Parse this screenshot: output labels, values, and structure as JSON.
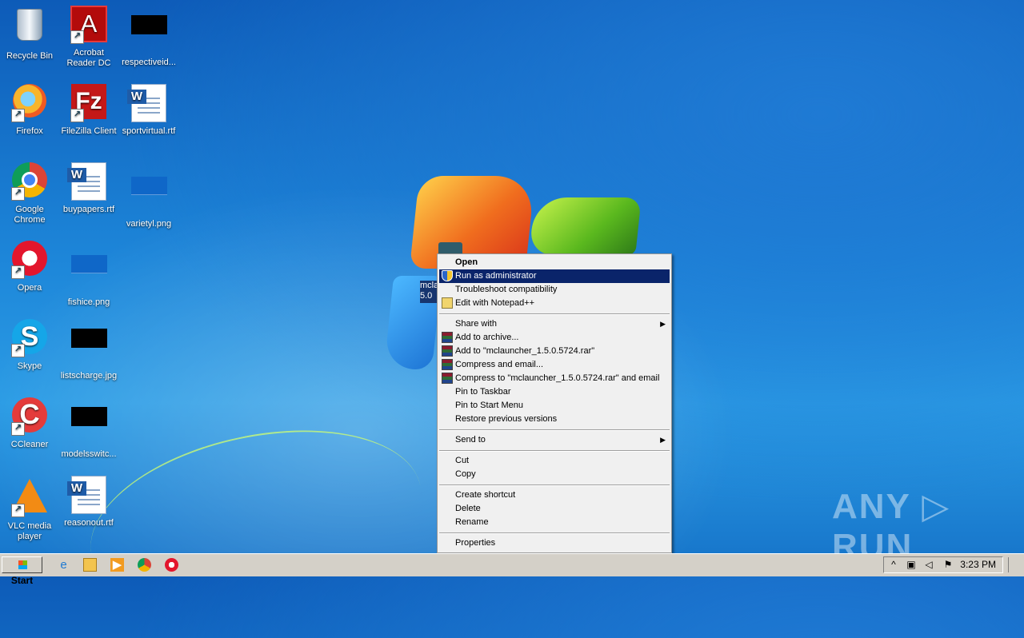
{
  "desktop": {
    "icons": [
      {
        "label": "Recycle Bin",
        "icon": "recycle-bin-icon"
      },
      {
        "label": "Acrobat\nReader DC",
        "icon": "acrobat-reader-icon"
      },
      {
        "label": "respectiveid...",
        "icon": "black-image-icon"
      },
      {
        "label": "Firefox",
        "icon": "firefox-icon"
      },
      {
        "label": "FileZilla Client",
        "icon": "filezilla-icon"
      },
      {
        "label": "sportvirtual.rtf",
        "icon": "word-document-icon"
      },
      {
        "label": "Google\nChrome",
        "icon": "chrome-icon"
      },
      {
        "label": "buypapers.rtf",
        "icon": "word-document-icon"
      },
      {
        "label": "varietyl.png",
        "icon": "image-file-icon"
      },
      {
        "label": "Opera",
        "icon": "opera-icon"
      },
      {
        "label": "fishice.png",
        "icon": "image-file-icon"
      },
      {
        "label": "Skype",
        "icon": "skype-icon"
      },
      {
        "label": "listscharge.jpg",
        "icon": "black-image-icon"
      },
      {
        "label": "CCleaner",
        "icon": "ccleaner-icon"
      },
      {
        "label": "modelsswitc...",
        "icon": "black-image-icon"
      },
      {
        "label": "VLC media\nplayer",
        "icon": "vlc-icon"
      },
      {
        "label": "reasonout.rtf",
        "icon": "word-document-icon"
      }
    ],
    "selected_file_partial": "mcla\n5.0",
    "watermark": "ANY ▷ RUN"
  },
  "context_menu": {
    "items": [
      {
        "label": "Open",
        "bold": true
      },
      {
        "label": "Run as administrator",
        "icon": "shield-icon",
        "active": true
      },
      {
        "label": "Troubleshoot compatibility"
      },
      {
        "label": "Edit with Notepad++",
        "icon": "notepad-icon"
      },
      {
        "label": "Share with",
        "submenu": true
      },
      {
        "label": "Add to archive...",
        "icon": "winrar-icon"
      },
      {
        "label": "Add to \"mclauncher_1.5.0.5724.rar\"",
        "icon": "winrar-icon"
      },
      {
        "label": "Compress and email...",
        "icon": "winrar-icon"
      },
      {
        "label": "Compress to \"mclauncher_1.5.0.5724.rar\" and email",
        "icon": "winrar-icon"
      },
      {
        "label": "Pin to Taskbar"
      },
      {
        "label": "Pin to Start Menu"
      },
      {
        "label": "Restore previous versions"
      },
      {
        "label": "Send to",
        "submenu": true
      },
      {
        "label": "Cut"
      },
      {
        "label": "Copy"
      },
      {
        "label": "Create shortcut"
      },
      {
        "label": "Delete"
      },
      {
        "label": "Rename"
      },
      {
        "label": "Properties"
      }
    ],
    "submenu_arrow": "▶"
  },
  "taskbar": {
    "start_label": "Start",
    "quick_launch": [
      "internet-explorer-icon",
      "folder-icon",
      "media-player-icon",
      "chrome-icon",
      "opera-icon"
    ],
    "tray_arrow": "^",
    "clock": "3:23 PM"
  },
  "colors": {
    "desktop_blue": "#1d86d9",
    "menu_highlight": "#0a246a",
    "taskbar_gray": "#d4d0c8"
  }
}
